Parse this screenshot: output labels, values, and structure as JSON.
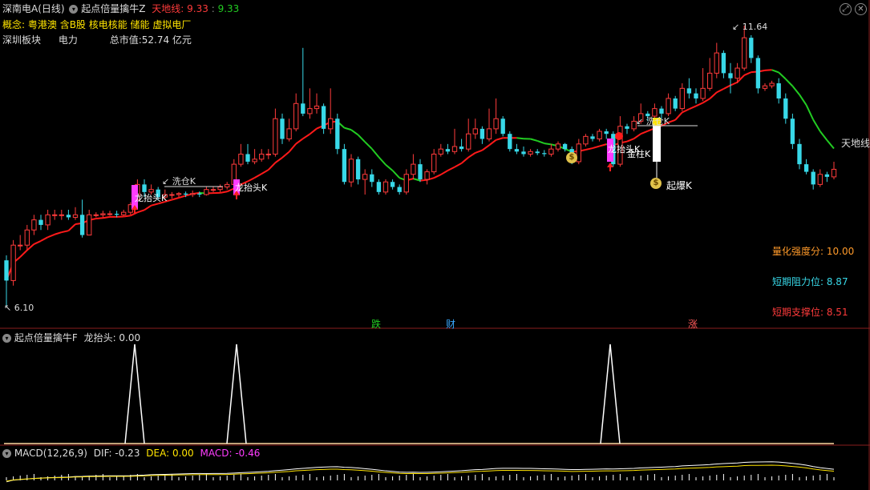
{
  "header": {
    "stock_name": "深南电A(日线)",
    "indicator_name": "起点倍量擒牛Z",
    "line_label": "天地线:",
    "line_value_red": "9.33",
    "line_value_green": "9.33"
  },
  "info": {
    "concept_label": "概念:",
    "concepts": "粤港澳 含B股 核电核能 储能 虚拟电厂",
    "sector_label": "深圳板块",
    "industry": "电力",
    "market_cap": "总市值:52.74 亿元"
  },
  "price": {
    "high_label": "11.64",
    "low_label": "6.10",
    "tiandi_label": "天地线"
  },
  "annotations": {
    "xicang": "洗仓K",
    "longtaitou": "龙抬头K",
    "longtaitou2": "龙抬头K",
    "longtai_tonggao": "龙抬头K",
    "xicang2": "洗仓K",
    "qibao": "起爆K",
    "jinzhu": "金柱K"
  },
  "stats": {
    "strength": "量化强度分: 10.00",
    "resistance": "短期阻力位: 8.87",
    "support": "短期支撑位: 8.51"
  },
  "markers": {
    "die": "跌",
    "cai": "财",
    "zhang": "涨"
  },
  "sub1": {
    "title": "起点倍量擒牛F",
    "value": "龙抬头: 0.00"
  },
  "sub2": {
    "title": "MACD(12,26,9)",
    "dif": "DIF: -0.23",
    "dea": "DEA: 0.00",
    "macd": "MACD: -0.46"
  },
  "colors": {
    "up": "#ff3b3b",
    "down": "#38d8e8",
    "ma_red": "#ff1a1a",
    "ma_green": "#22cc22",
    "magenta": "#ff3cff",
    "yellow": "#ffe400",
    "orange": "#ff9a2a",
    "cyan": "#38d8e8"
  },
  "chart_data": {
    "type": "candlestick",
    "y_range": [
      6.1,
      11.64
    ],
    "candles": [
      [
        7.0,
        6.6,
        7.1,
        6.1
      ],
      [
        6.6,
        7.3,
        7.4,
        6.5
      ],
      [
        7.3,
        7.3,
        7.5,
        7.2
      ],
      [
        7.3,
        7.6,
        7.7,
        7.2
      ],
      [
        7.6,
        7.8,
        7.9,
        7.5
      ],
      [
        7.8,
        7.7,
        7.9,
        7.6
      ],
      [
        7.7,
        7.9,
        8.0,
        7.6
      ],
      [
        7.9,
        7.9,
        8.0,
        7.8
      ],
      [
        7.9,
        7.9,
        8.0,
        7.8
      ],
      [
        7.9,
        7.85,
        8.0,
        7.8
      ],
      [
        7.85,
        7.9,
        8.05,
        7.8
      ],
      [
        7.9,
        7.5,
        8.2,
        7.45
      ],
      [
        7.5,
        7.9,
        8.0,
        7.5
      ],
      [
        7.9,
        7.9,
        7.95,
        7.85
      ],
      [
        7.9,
        7.92,
        7.98,
        7.85
      ],
      [
        7.92,
        7.92,
        7.98,
        7.88
      ],
      [
        7.92,
        7.9,
        7.98,
        7.85
      ],
      [
        7.9,
        7.95,
        8.0,
        7.88
      ],
      [
        7.95,
        8.1,
        8.15,
        7.9
      ],
      [
        8.2,
        8.5,
        8.6,
        8.1
      ],
      [
        8.5,
        8.35,
        8.6,
        8.25
      ],
      [
        8.35,
        8.4,
        8.5,
        8.3
      ],
      [
        8.4,
        8.25,
        8.45,
        8.2
      ],
      [
        8.25,
        8.3,
        8.4,
        8.2
      ],
      [
        8.3,
        8.3,
        8.35,
        8.22
      ],
      [
        8.3,
        8.32,
        8.35,
        8.25
      ],
      [
        8.32,
        8.3,
        8.36,
        8.25
      ],
      [
        8.3,
        8.32,
        8.38,
        8.25
      ],
      [
        8.32,
        8.3,
        8.36,
        8.25
      ],
      [
        8.3,
        8.4,
        8.45,
        8.28
      ],
      [
        8.4,
        8.4,
        8.45,
        8.35
      ],
      [
        8.4,
        8.45,
        8.5,
        8.35
      ],
      [
        8.45,
        8.5,
        8.55,
        8.4
      ],
      [
        8.5,
        8.9,
        9.0,
        8.45
      ],
      [
        8.9,
        9.1,
        9.3,
        8.85
      ],
      [
        9.1,
        8.95,
        9.3,
        8.9
      ],
      [
        8.95,
        9.0,
        9.2,
        8.9
      ],
      [
        9.0,
        9.1,
        9.2,
        8.95
      ],
      [
        9.1,
        9.1,
        9.2,
        9.0
      ],
      [
        9.1,
        9.8,
        10.0,
        9.05
      ],
      [
        9.8,
        9.4,
        9.9,
        9.3
      ],
      [
        9.4,
        9.6,
        9.8,
        9.35
      ],
      [
        9.6,
        10.1,
        10.3,
        9.55
      ],
      [
        10.1,
        9.9,
        11.2,
        9.85
      ],
      [
        9.9,
        10.0,
        10.4,
        9.8
      ],
      [
        10.0,
        10.05,
        10.3,
        9.9
      ],
      [
        10.05,
        9.6,
        10.1,
        9.5
      ],
      [
        9.6,
        9.8,
        10.4,
        9.5
      ],
      [
        9.8,
        9.2,
        9.9,
        9.1
      ],
      [
        9.2,
        8.55,
        9.3,
        8.5
      ],
      [
        8.55,
        9.0,
        9.1,
        8.45
      ],
      [
        9.0,
        8.6,
        9.05,
        8.5
      ],
      [
        8.6,
        8.7,
        8.8,
        8.3
      ],
      [
        8.7,
        8.55,
        8.8,
        8.45
      ],
      [
        8.55,
        8.35,
        8.6,
        8.3
      ],
      [
        8.35,
        8.55,
        8.6,
        8.3
      ],
      [
        8.55,
        8.45,
        8.6,
        8.4
      ],
      [
        8.45,
        8.35,
        8.5,
        8.3
      ],
      [
        8.35,
        8.7,
        8.8,
        8.3
      ],
      [
        8.7,
        8.9,
        9.1,
        8.6
      ],
      [
        8.9,
        8.6,
        9.0,
        8.55
      ],
      [
        8.6,
        8.75,
        8.8,
        8.5
      ],
      [
        8.75,
        9.1,
        9.2,
        8.7
      ],
      [
        9.1,
        9.2,
        9.3,
        9.05
      ],
      [
        9.2,
        9.15,
        9.3,
        9.1
      ],
      [
        9.15,
        9.25,
        9.6,
        9.1
      ],
      [
        9.25,
        9.2,
        9.4,
        9.15
      ],
      [
        9.2,
        9.5,
        9.8,
        9.15
      ],
      [
        9.5,
        9.6,
        9.8,
        9.4
      ],
      [
        9.6,
        9.4,
        9.65,
        9.3
      ],
      [
        9.4,
        9.6,
        10.0,
        9.35
      ],
      [
        9.6,
        9.8,
        10.2,
        9.5
      ],
      [
        9.8,
        9.5,
        9.85,
        9.45
      ],
      [
        9.5,
        9.2,
        9.55,
        9.15
      ],
      [
        9.2,
        9.15,
        9.3,
        9.1
      ],
      [
        9.15,
        9.1,
        9.25,
        9.05
      ],
      [
        9.1,
        9.15,
        9.2,
        9.05
      ],
      [
        9.15,
        9.12,
        9.2,
        9.08
      ],
      [
        9.12,
        9.1,
        9.18,
        9.05
      ],
      [
        9.1,
        9.2,
        9.3,
        9.05
      ],
      [
        9.2,
        9.3,
        9.35,
        9.15
      ],
      [
        9.3,
        9.2,
        9.32,
        9.15
      ],
      [
        9.2,
        8.95,
        9.25,
        8.9
      ],
      [
        8.95,
        9.3,
        9.4,
        8.9
      ],
      [
        9.3,
        9.45,
        9.5,
        9.25
      ],
      [
        9.45,
        9.4,
        9.5,
        9.35
      ],
      [
        9.4,
        9.55,
        9.6,
        9.35
      ],
      [
        9.55,
        9.5,
        9.6,
        9.4
      ],
      [
        9.5,
        8.9,
        9.55,
        8.85
      ],
      [
        8.9,
        9.65,
        9.85,
        8.85
      ],
      [
        9.65,
        9.6,
        9.7,
        9.5
      ],
      [
        9.6,
        9.75,
        9.85,
        9.55
      ],
      [
        9.75,
        9.9,
        10.1,
        9.7
      ],
      [
        9.9,
        9.85,
        9.95,
        9.75
      ],
      [
        9.85,
        10.0,
        10.1,
        9.8
      ],
      [
        10.0,
        9.9,
        10.05,
        9.8
      ],
      [
        9.9,
        10.2,
        10.3,
        9.85
      ],
      [
        10.2,
        10.0,
        10.25,
        9.95
      ],
      [
        10.0,
        10.4,
        10.5,
        9.95
      ],
      [
        10.4,
        10.3,
        10.6,
        10.2
      ],
      [
        10.3,
        10.2,
        10.4,
        10.1
      ],
      [
        10.2,
        10.4,
        10.8,
        10.15
      ],
      [
        10.4,
        10.7,
        11.0,
        10.35
      ],
      [
        10.7,
        11.1,
        11.3,
        10.6
      ],
      [
        11.1,
        10.7,
        11.15,
        10.6
      ],
      [
        10.7,
        10.6,
        10.9,
        10.3
      ],
      [
        10.6,
        10.8,
        10.9,
        10.5
      ],
      [
        10.8,
        11.4,
        11.64,
        10.75
      ],
      [
        11.4,
        11.0,
        11.45,
        10.9
      ],
      [
        11.0,
        10.4,
        11.05,
        10.3
      ],
      [
        10.4,
        10.45,
        10.5,
        10.35
      ],
      [
        10.45,
        10.5,
        10.55,
        10.4
      ],
      [
        10.5,
        10.2,
        10.6,
        10.1
      ],
      [
        10.2,
        9.8,
        10.3,
        9.7
      ],
      [
        9.8,
        9.3,
        9.9,
        9.2
      ],
      [
        9.3,
        8.9,
        9.4,
        8.8
      ],
      [
        8.9,
        8.75,
        9.0,
        8.7
      ],
      [
        8.75,
        8.5,
        8.8,
        8.4
      ],
      [
        8.5,
        8.7,
        8.8,
        8.45
      ],
      [
        8.7,
        8.65,
        8.75,
        8.55
      ],
      [
        8.65,
        8.8,
        8.95,
        8.6
      ]
    ]
  }
}
